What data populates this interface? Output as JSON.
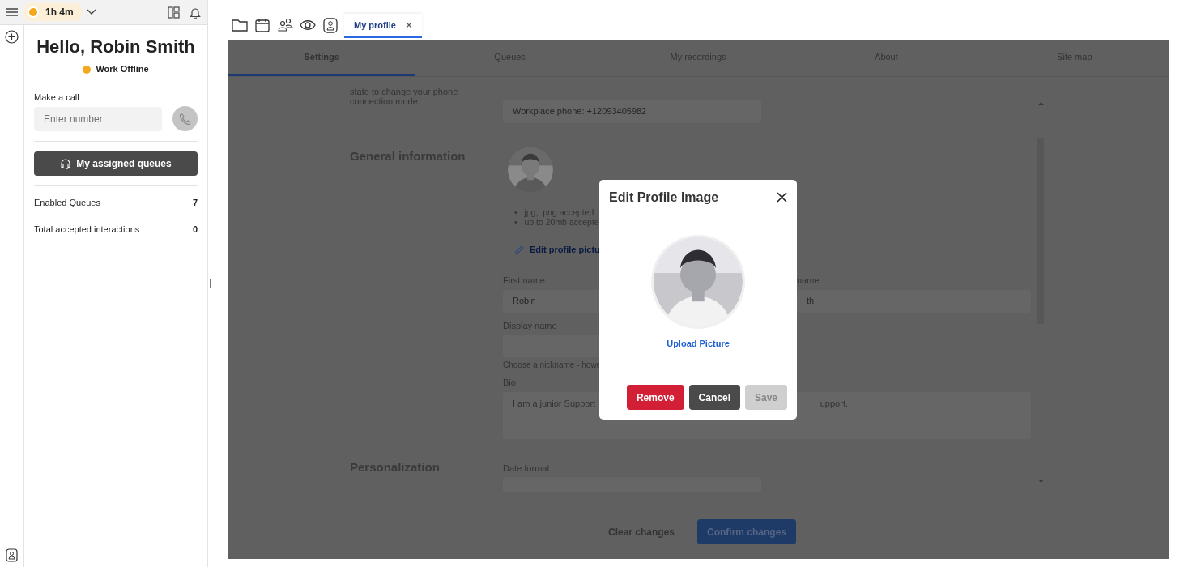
{
  "topbar": {
    "timer": "1h 4m"
  },
  "sidebar": {
    "greeting": "Hello, Robin Smith",
    "status": "Work Offline",
    "call_label": "Make a call",
    "number_placeholder": "Enter number",
    "queues_button": "My assigned queues",
    "stats": [
      {
        "label": "Enabled Queues",
        "value": "7"
      },
      {
        "label": "Total accepted interactions",
        "value": "0"
      }
    ]
  },
  "tabs": [
    {
      "label": "My profile",
      "selected": true
    }
  ],
  "settings_tabs": [
    {
      "label": "Settings",
      "selected": true
    },
    {
      "label": "Queues",
      "selected": false
    },
    {
      "label": "My recordings",
      "selected": false
    },
    {
      "label": "About",
      "selected": false
    },
    {
      "label": "Site map",
      "selected": false
    }
  ],
  "form": {
    "intro": [
      "state to change your phone",
      "connection mode."
    ],
    "phone": "Workplace phone: +12093405982",
    "general_title": "General information",
    "bullet_marker": "•",
    "bullets": [
      "jpg, .png accepted",
      "up to 20mb accepte"
    ],
    "edit_link": "Edit profile pictu",
    "first_name_label": "First name",
    "first_name": "Robin",
    "last_name_label": "name",
    "last_name": "th",
    "display_name_label": "Display name",
    "display_hint": "Choose a nickname - howe",
    "bio_label": "Bio",
    "bio_left": "I am a junior Support",
    "bio_right": "upport.",
    "personal_title": "Personalization",
    "date_label": "Date format"
  },
  "footer_buttons": [
    {
      "label": "Clear changes",
      "kind": "link"
    },
    {
      "label": "Confirm changes",
      "kind": "primary"
    }
  ],
  "modal": {
    "title": "Edit Profile Image",
    "upload_link": "Upload Picture",
    "buttons": [
      {
        "label": "Remove",
        "kind": "danger",
        "disabled": false
      },
      {
        "label": "Cancel",
        "kind": "dark",
        "disabled": false
      },
      {
        "label": "Save",
        "kind": "light",
        "disabled": true
      }
    ]
  }
}
